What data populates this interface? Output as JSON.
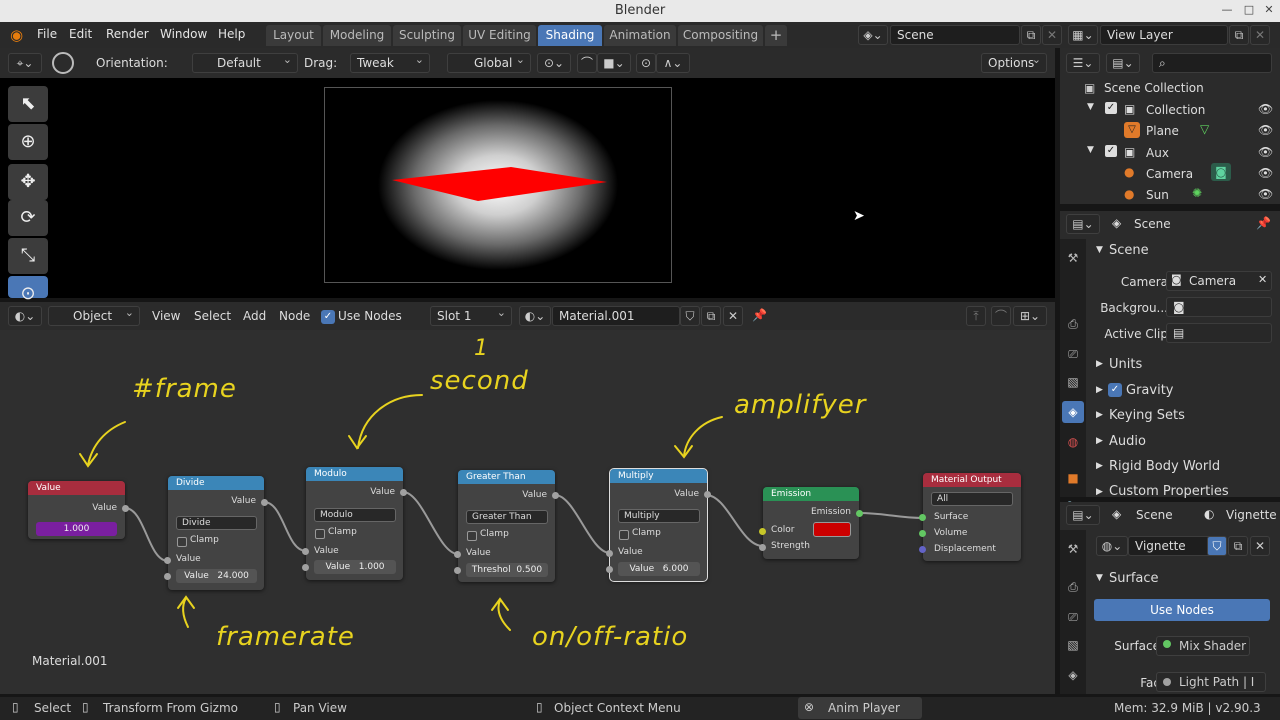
{
  "window": {
    "title": "Blender"
  },
  "menubar": {
    "items": [
      "File",
      "Edit",
      "Render",
      "Window",
      "Help"
    ],
    "workspaces": [
      "Layout",
      "Modeling",
      "Sculpting",
      "UV Editing",
      "Shading",
      "Animation",
      "Compositing"
    ],
    "active_workspace": "Shading",
    "scene": "Scene",
    "view_layer": "View Layer"
  },
  "viewport": {
    "orientation_label": "Orientation:",
    "orientation": "Default",
    "drag_label": "Drag:",
    "drag": "Tweak",
    "transform": "Global",
    "options": "Options"
  },
  "node_editor": {
    "object_mode": "Object",
    "menus": [
      "View",
      "Select",
      "Add",
      "Node"
    ],
    "use_nodes": "Use Nodes",
    "slot": "Slot 1",
    "material": "Material.001",
    "footer_label": "Material.001"
  },
  "nodes": {
    "value": {
      "title": "Value",
      "out": "Value",
      "value": "1.000"
    },
    "divide": {
      "title": "Divide",
      "out": "Value",
      "op": "Divide",
      "clamp": "Clamp",
      "in": "Value",
      "field_label": "Value",
      "field_value": "24.000"
    },
    "modulo": {
      "title": "Modulo",
      "out": "Value",
      "op": "Modulo",
      "clamp": "Clamp",
      "in": "Value",
      "field_label": "Value",
      "field_value": "1.000"
    },
    "greater": {
      "title": "Greater Than",
      "out": "Value",
      "op": "Greater Than",
      "clamp": "Clamp",
      "in": "Value",
      "field_label": "Threshol",
      "field_value": "0.500"
    },
    "multiply": {
      "title": "Multiply",
      "out": "Value",
      "op": "Multiply",
      "clamp": "Clamp",
      "in": "Value",
      "field_label": "Value",
      "field_value": "6.000"
    },
    "emission": {
      "title": "Emission",
      "out": "Emission",
      "color": "Color",
      "strength": "Strength",
      "color_hex": "#cc0000"
    },
    "output": {
      "title": "Material Output",
      "target": "All",
      "surface": "Surface",
      "volume": "Volume",
      "displacement": "Displacement"
    }
  },
  "annotations": {
    "frame": "#frame",
    "second_num": "1",
    "second": "second",
    "amp": "amplifyer",
    "framerate": "framerate",
    "ratio": "on/off-ratio"
  },
  "outliner": {
    "root": "Scene Collection",
    "items": [
      {
        "label": "Collection"
      },
      {
        "label": "Plane"
      },
      {
        "label": "Aux"
      },
      {
        "label": "Camera"
      },
      {
        "label": "Sun"
      }
    ]
  },
  "properties": {
    "context": "Scene",
    "section": "Scene",
    "camera_label": "Camera",
    "camera_value": "Camera",
    "background_label": "Backgrou...",
    "active_clip_label": "Active Clip",
    "panels": [
      "Units",
      "Gravity",
      "Keying Sets",
      "Audio",
      "Rigid Body World",
      "Custom Properties"
    ]
  },
  "properties2": {
    "context": "Scene",
    "material_tab": "Vignette",
    "material": "Vignette",
    "section": "Surface",
    "use_nodes": "Use Nodes",
    "surface_label": "Surface",
    "surface_value": "Mix Shader",
    "fac_label": "Fac",
    "fac_value": "Light Path | I"
  },
  "statusbar": {
    "select": "Select",
    "transform": "Transform From Gizmo",
    "pan": "Pan View",
    "context": "Object Context Menu",
    "anim": "Anim Player",
    "mem": "Mem: 32.9 MiB | v2.90.3"
  },
  "colors": {
    "accent": "#4a77b6",
    "value_node": "#a82d3e",
    "converter": "#3b86b8",
    "shader": "#2a9155",
    "output": "#a82d3e",
    "annotation": "#e8d31f"
  }
}
